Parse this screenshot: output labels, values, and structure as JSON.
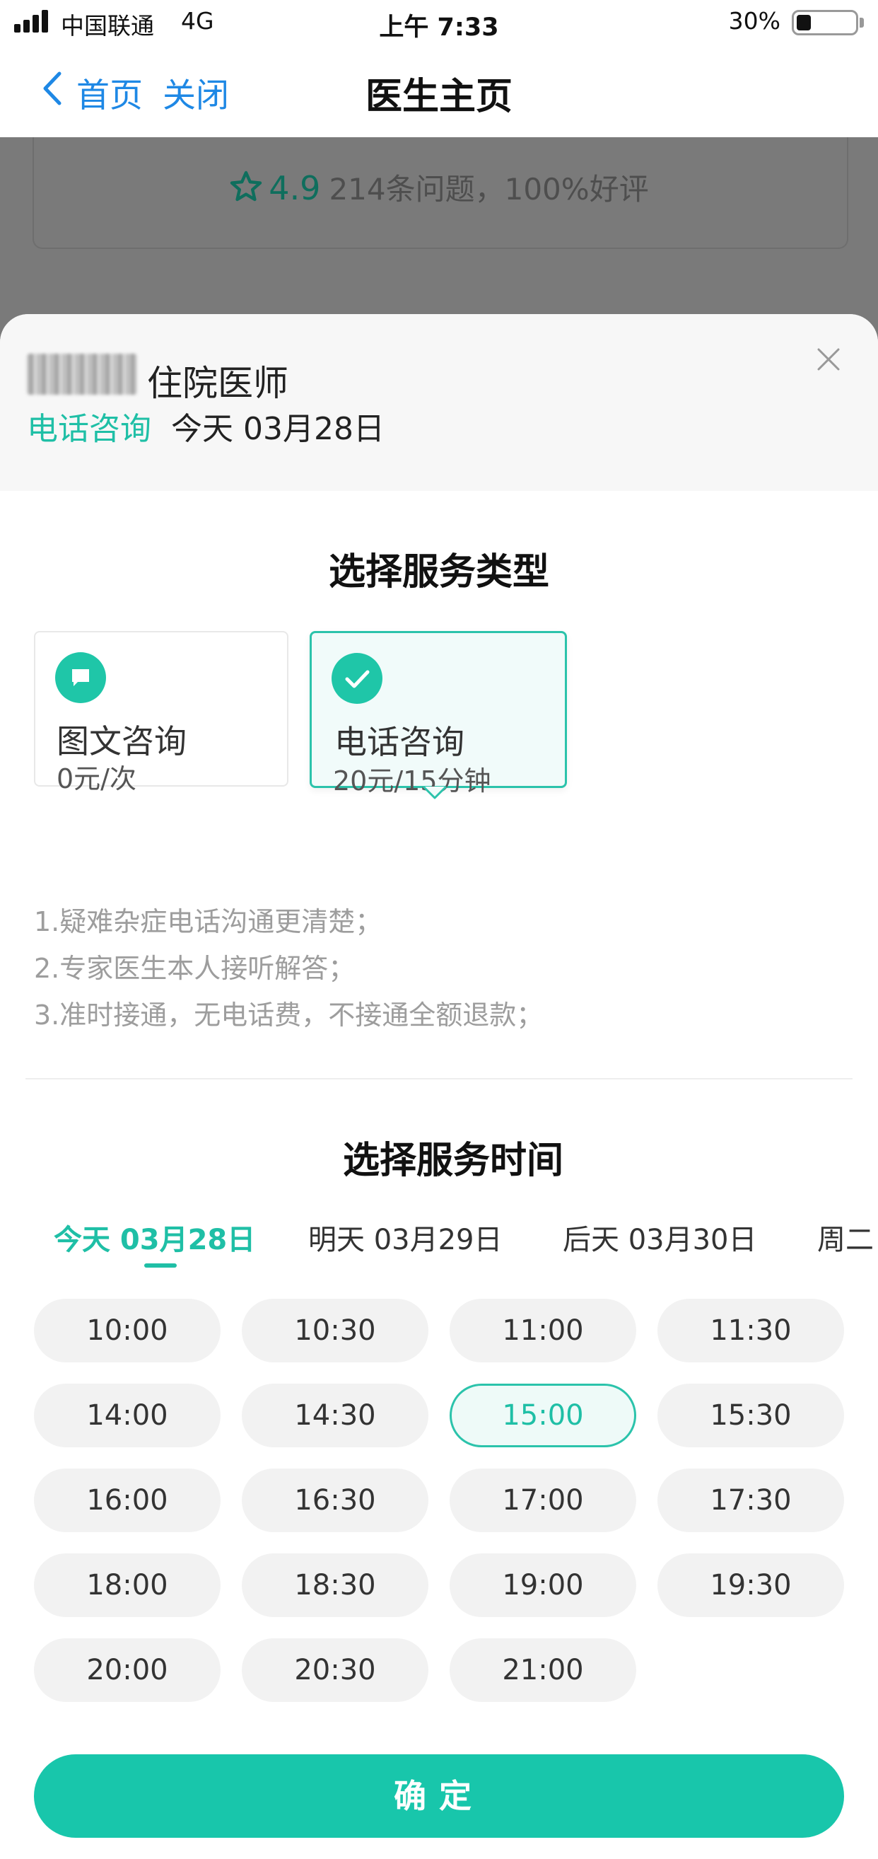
{
  "status_bar": {
    "carrier": "中国联通",
    "network": "4G",
    "time": "上午 7:33",
    "battery": "30%",
    "battery_level": 0.3
  },
  "nav": {
    "back_icon": "chevron-left-icon",
    "home_label": "首页",
    "close_label": "关闭",
    "title": "医生主页"
  },
  "background": {
    "rating_score": "4.9",
    "rating_text": "214条问题，100%好评"
  },
  "sheet": {
    "doctor_title": "住院医师",
    "consult_type": "电话咨询",
    "consult_date": "今天 03月28日",
    "service_title": "选择服务类型",
    "services": [
      {
        "name": "图文咨询",
        "price": "0元/次",
        "icon": "chat-bubble-icon",
        "selected": false
      },
      {
        "name": "电话咨询",
        "price": "20元/15分钟",
        "icon": "check-circle-icon",
        "selected": true
      }
    ],
    "features": [
      "1.疑难杂症电话沟通更清楚；",
      "2.专家医生本人接听解答；",
      "3.准时接通，无电话费，不接通全额退款；"
    ],
    "time_title": "选择服务时间",
    "date_tabs": [
      {
        "label": "今天 03月28日",
        "active": true
      },
      {
        "label": "明天 03月29日",
        "active": false
      },
      {
        "label": "后天 03月30日",
        "active": false
      },
      {
        "label": "周二",
        "active": false
      }
    ],
    "slots": [
      "10:00",
      "10:30",
      "11:00",
      "11:30",
      "14:00",
      "14:30",
      "15:00",
      "15:30",
      "16:00",
      "16:30",
      "17:00",
      "17:30",
      "18:00",
      "18:30",
      "19:00",
      "19:30",
      "20:00",
      "20:30",
      "21:00"
    ],
    "selected_slot": "15:00",
    "confirm_label": "确定"
  },
  "colors": {
    "accent": "#1fbfa6",
    "button": "#18c6ab",
    "link": "#1e88e5"
  }
}
